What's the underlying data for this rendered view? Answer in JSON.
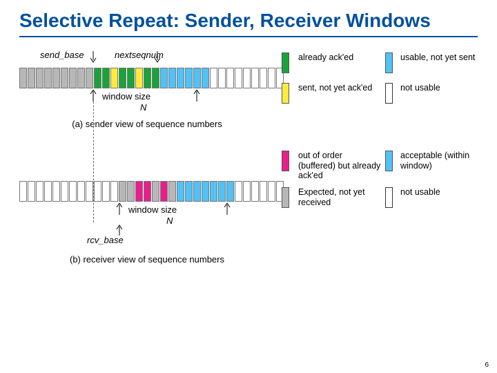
{
  "title": "Selective Repeat: Sender, Receiver Windows",
  "sender": {
    "label_send_base": "send_base",
    "label_nextseqnum": "nextseqnum",
    "window_label": "window size",
    "window_N": "N",
    "caption": "(a) sender view of sequence numbers",
    "cells": [
      "gray",
      "gray",
      "gray",
      "gray",
      "gray",
      "gray",
      "gray",
      "gray",
      "gray",
      "green",
      "green",
      "yellow",
      "green",
      "green",
      "yellow",
      "green",
      "green",
      "blue",
      "blue",
      "blue",
      "blue",
      "blue",
      "blue",
      "white",
      "white",
      "white",
      "white",
      "white",
      "white",
      "white",
      "white",
      "white"
    ]
  },
  "receiver": {
    "label_rcv_base": "rcv_base",
    "window_label": "window size",
    "window_N": "N",
    "caption": "(b) receiver view of sequence numbers",
    "cells": [
      "white",
      "white",
      "white",
      "white",
      "white",
      "white",
      "white",
      "white",
      "white",
      "white",
      "white",
      "white",
      "gray",
      "gray",
      "magenta",
      "magenta",
      "gray",
      "magenta",
      "gray",
      "blue",
      "blue",
      "blue",
      "blue",
      "blue",
      "blue",
      "blue",
      "white",
      "white",
      "white",
      "white",
      "white",
      "white"
    ]
  },
  "legend_sender": {
    "acked": "already ack'ed",
    "usable": "usable, not yet sent",
    "sent": "sent, not yet ack'ed",
    "not_usable": "not usable"
  },
  "legend_receiver": {
    "buffered": "out of order (buffered) but already ack'ed",
    "acceptable": "acceptable (within window)",
    "expected": "Expected,  not yet received",
    "not_usable": "not usable"
  },
  "page_number": "6"
}
